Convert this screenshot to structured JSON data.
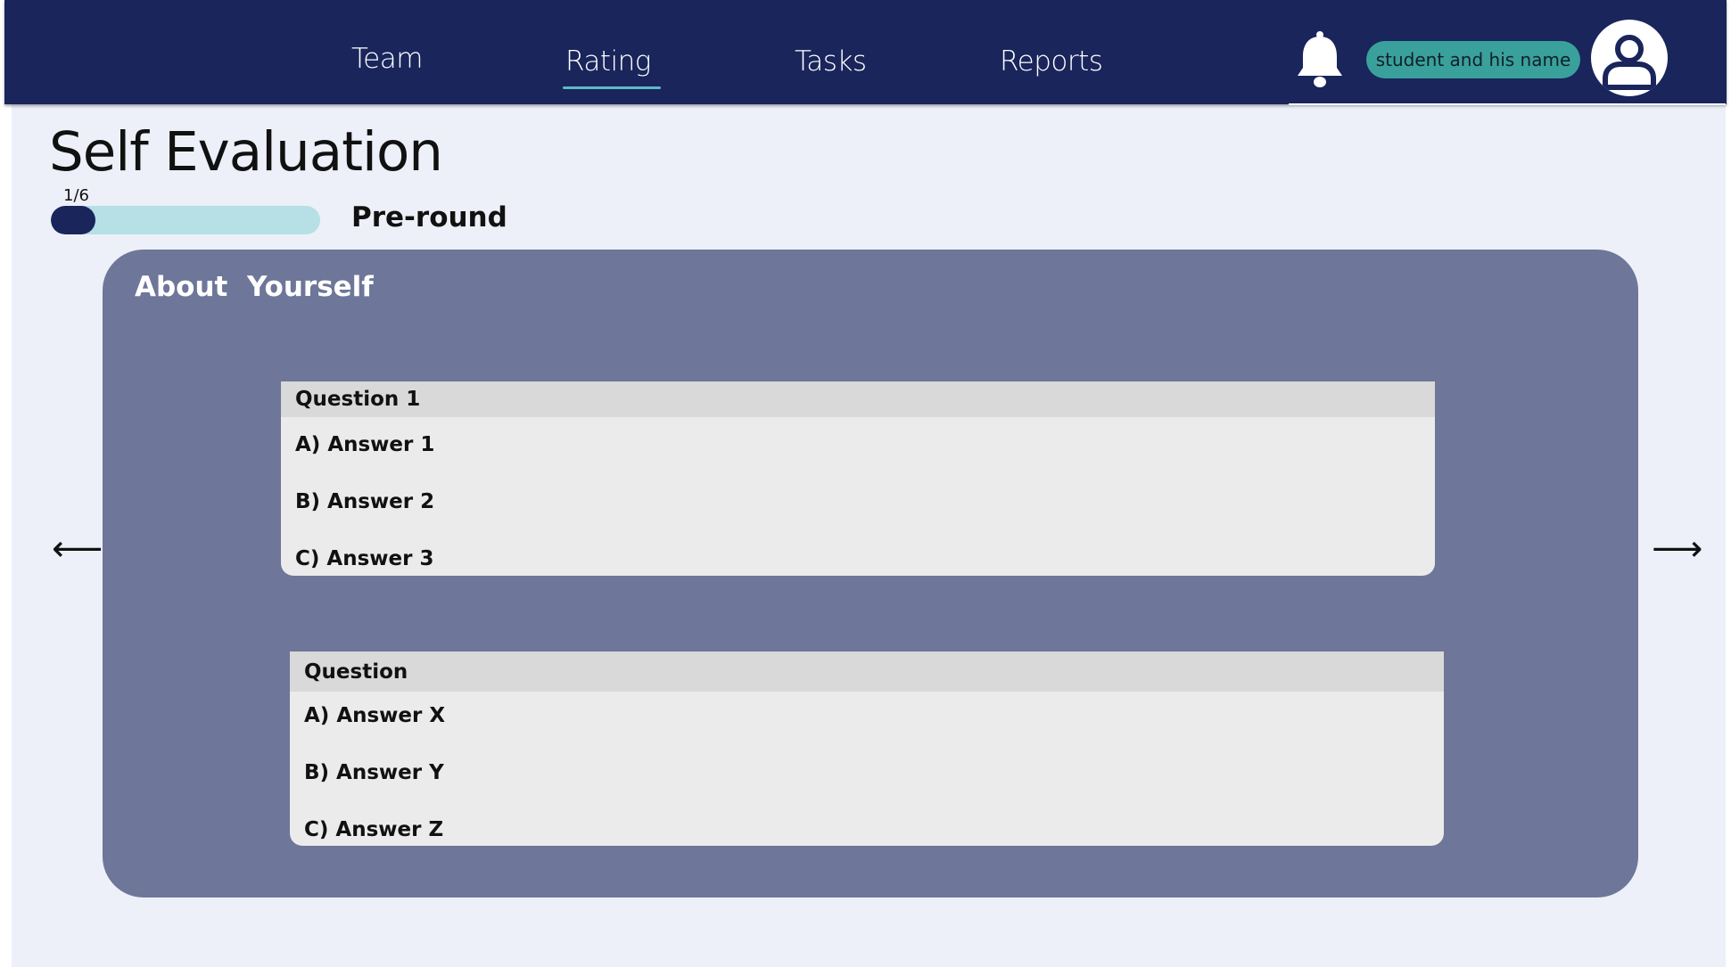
{
  "nav": {
    "items": [
      {
        "label": "Team"
      },
      {
        "label": "Rating"
      },
      {
        "label": "Tasks"
      },
      {
        "label": "Reports"
      }
    ],
    "active": "Rating",
    "notification_icon": "bell-icon",
    "user_name": "student and his name",
    "avatar_icon": "user-avatar-icon"
  },
  "page": {
    "title": "Self Evaluation",
    "progress": {
      "label": "1/6",
      "current": 1,
      "total": 6
    },
    "round": "Pre-round"
  },
  "card": {
    "title": "About  Yourself",
    "questions": [
      {
        "title": "Question 1",
        "options": [
          "A) Answer 1",
          "B) Answer 2",
          "C) Answer 3"
        ]
      },
      {
        "title": "Question",
        "options": [
          "A) Answer X",
          "B) Answer Y",
          "C) Answer Z"
        ]
      }
    ]
  },
  "navigation": {
    "prev": "⟵",
    "next": "⟶"
  },
  "colors": {
    "header": "#19255b",
    "accent": "#3aa09b",
    "card": "#6e7699",
    "progress_track": "#b6dfe6",
    "page_background": "#edf0f8"
  }
}
